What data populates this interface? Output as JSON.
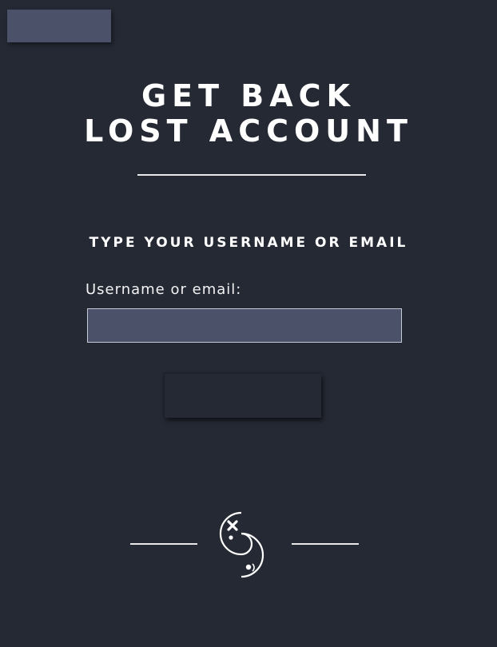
{
  "header": {
    "title_line1": "GET BACK",
    "title_line2": "LOST ACCOUNT"
  },
  "form": {
    "subtitle": "TYPE YOUR USERNAME OR EMAIL",
    "field_label": "Username or email:",
    "field_value": "",
    "submit_label": ""
  },
  "icons": {
    "footer_emblem": "yin-yang-x-dot-icon"
  },
  "colors": {
    "background": "#252933",
    "accent_panel": "#4a5169",
    "text": "#ffffff"
  }
}
